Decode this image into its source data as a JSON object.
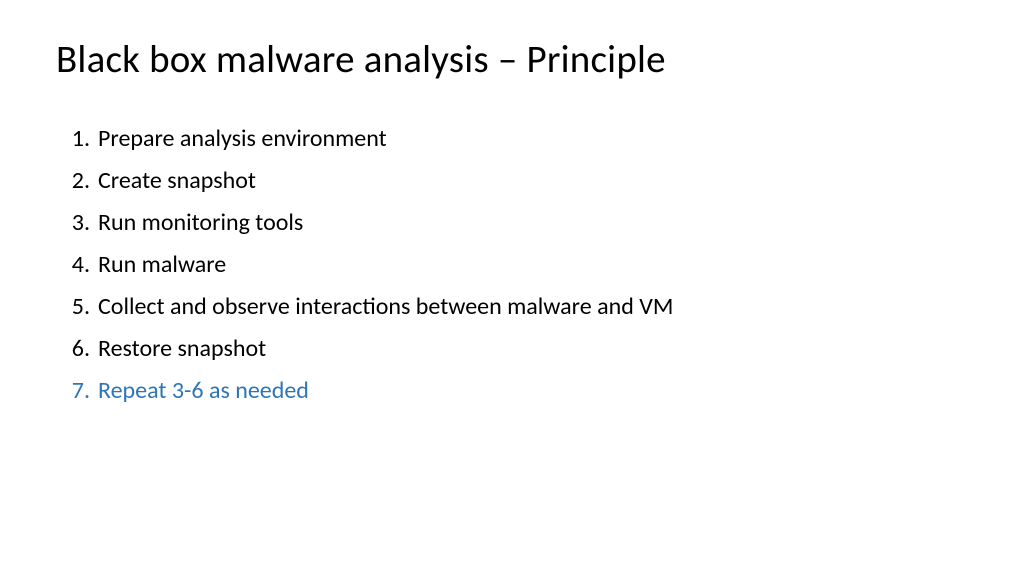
{
  "title": "Black box malware analysis – Principle",
  "items": [
    {
      "text": "Prepare analysis environment",
      "accent": false
    },
    {
      "text": "Create snapshot",
      "accent": false
    },
    {
      "text": "Run monitoring tools",
      "accent": false
    },
    {
      "text": "Run malware",
      "accent": false
    },
    {
      "text": "Collect and observe interactions between malware and VM",
      "accent": false
    },
    {
      "text": "Restore snapshot",
      "accent": false
    },
    {
      "text": "Repeat 3-6 as needed",
      "accent": true
    }
  ]
}
